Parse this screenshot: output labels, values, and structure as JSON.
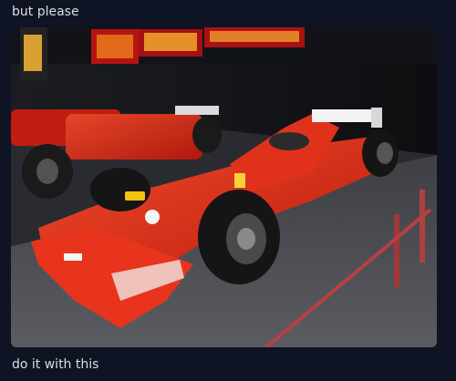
{
  "messages": [
    {
      "text": "but please"
    },
    {
      "text": "do it with this"
    }
  ],
  "attachment": {
    "kind": "image",
    "description_icon": "photo-attachment"
  }
}
